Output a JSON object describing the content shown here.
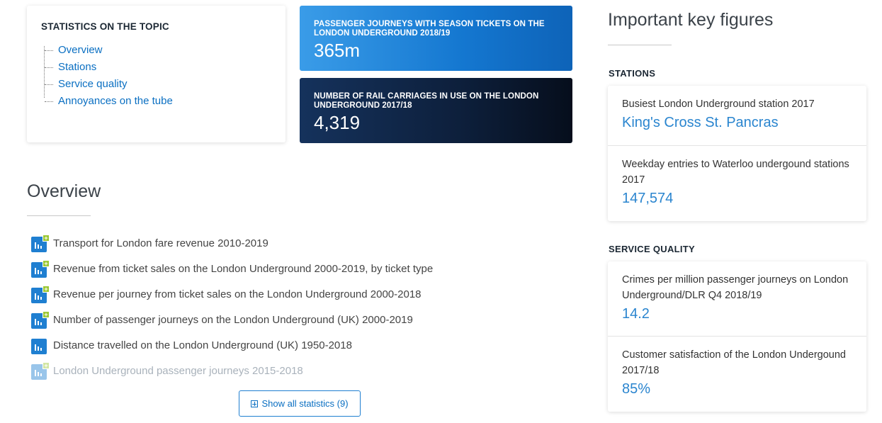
{
  "topics": {
    "title": "STATISTICS ON THE TOPIC",
    "items": [
      "Overview",
      "Stations",
      "Service quality",
      "Annoyances on the tube"
    ]
  },
  "cards": [
    {
      "label": "PASSENGER JOURNEYS WITH SEASON TICKETS ON THE LONDON UNDERGROUND 2018/19",
      "value": "365m"
    },
    {
      "label": "NUMBER OF RAIL CARRIAGES IN USE ON THE LONDON UNDERGROUND 2017/18",
      "value": "4,319"
    }
  ],
  "overview": {
    "heading": "Overview",
    "items": [
      "Transport for London fare revenue 2010-2019",
      "Revenue from ticket sales on the London Underground 2000-2019, by ticket type",
      "Revenue per journey from ticket sales on the London Underground 2000-2018",
      "Number of passenger journeys on the London Underground (UK) 2000-2019",
      "Distance travelled on the London Underground (UK) 1950-2018",
      "London Underground passenger journeys 2015-2018"
    ],
    "show_all_label": "Show all statistics (9)"
  },
  "key_figures": {
    "heading": "Important key figures",
    "stations": {
      "title": "STATIONS",
      "items": [
        {
          "label": "Busiest London Underground station 2017",
          "value": "King's Cross St. Pancras"
        },
        {
          "label": "Weekday entries to Waterloo undergound stations 2017",
          "value": "147,574"
        }
      ]
    },
    "service_quality": {
      "title": "SERVICE QUALITY",
      "items": [
        {
          "label": "Crimes per million passenger journeys on London Underground/DLR Q4 2018/19",
          "value": "14.2"
        },
        {
          "label": "Customer satisfaction of the London Undergound 2017/18",
          "value": "85%"
        }
      ]
    }
  },
  "colors": {
    "link": "#0a6fc2",
    "accent_blue": "#1f7fd1",
    "card_dark": "#0d1f3b",
    "icon_plus": "#9cc834"
  },
  "icons": {
    "chart": "bar-chart-icon",
    "plus": "plus-icon"
  }
}
